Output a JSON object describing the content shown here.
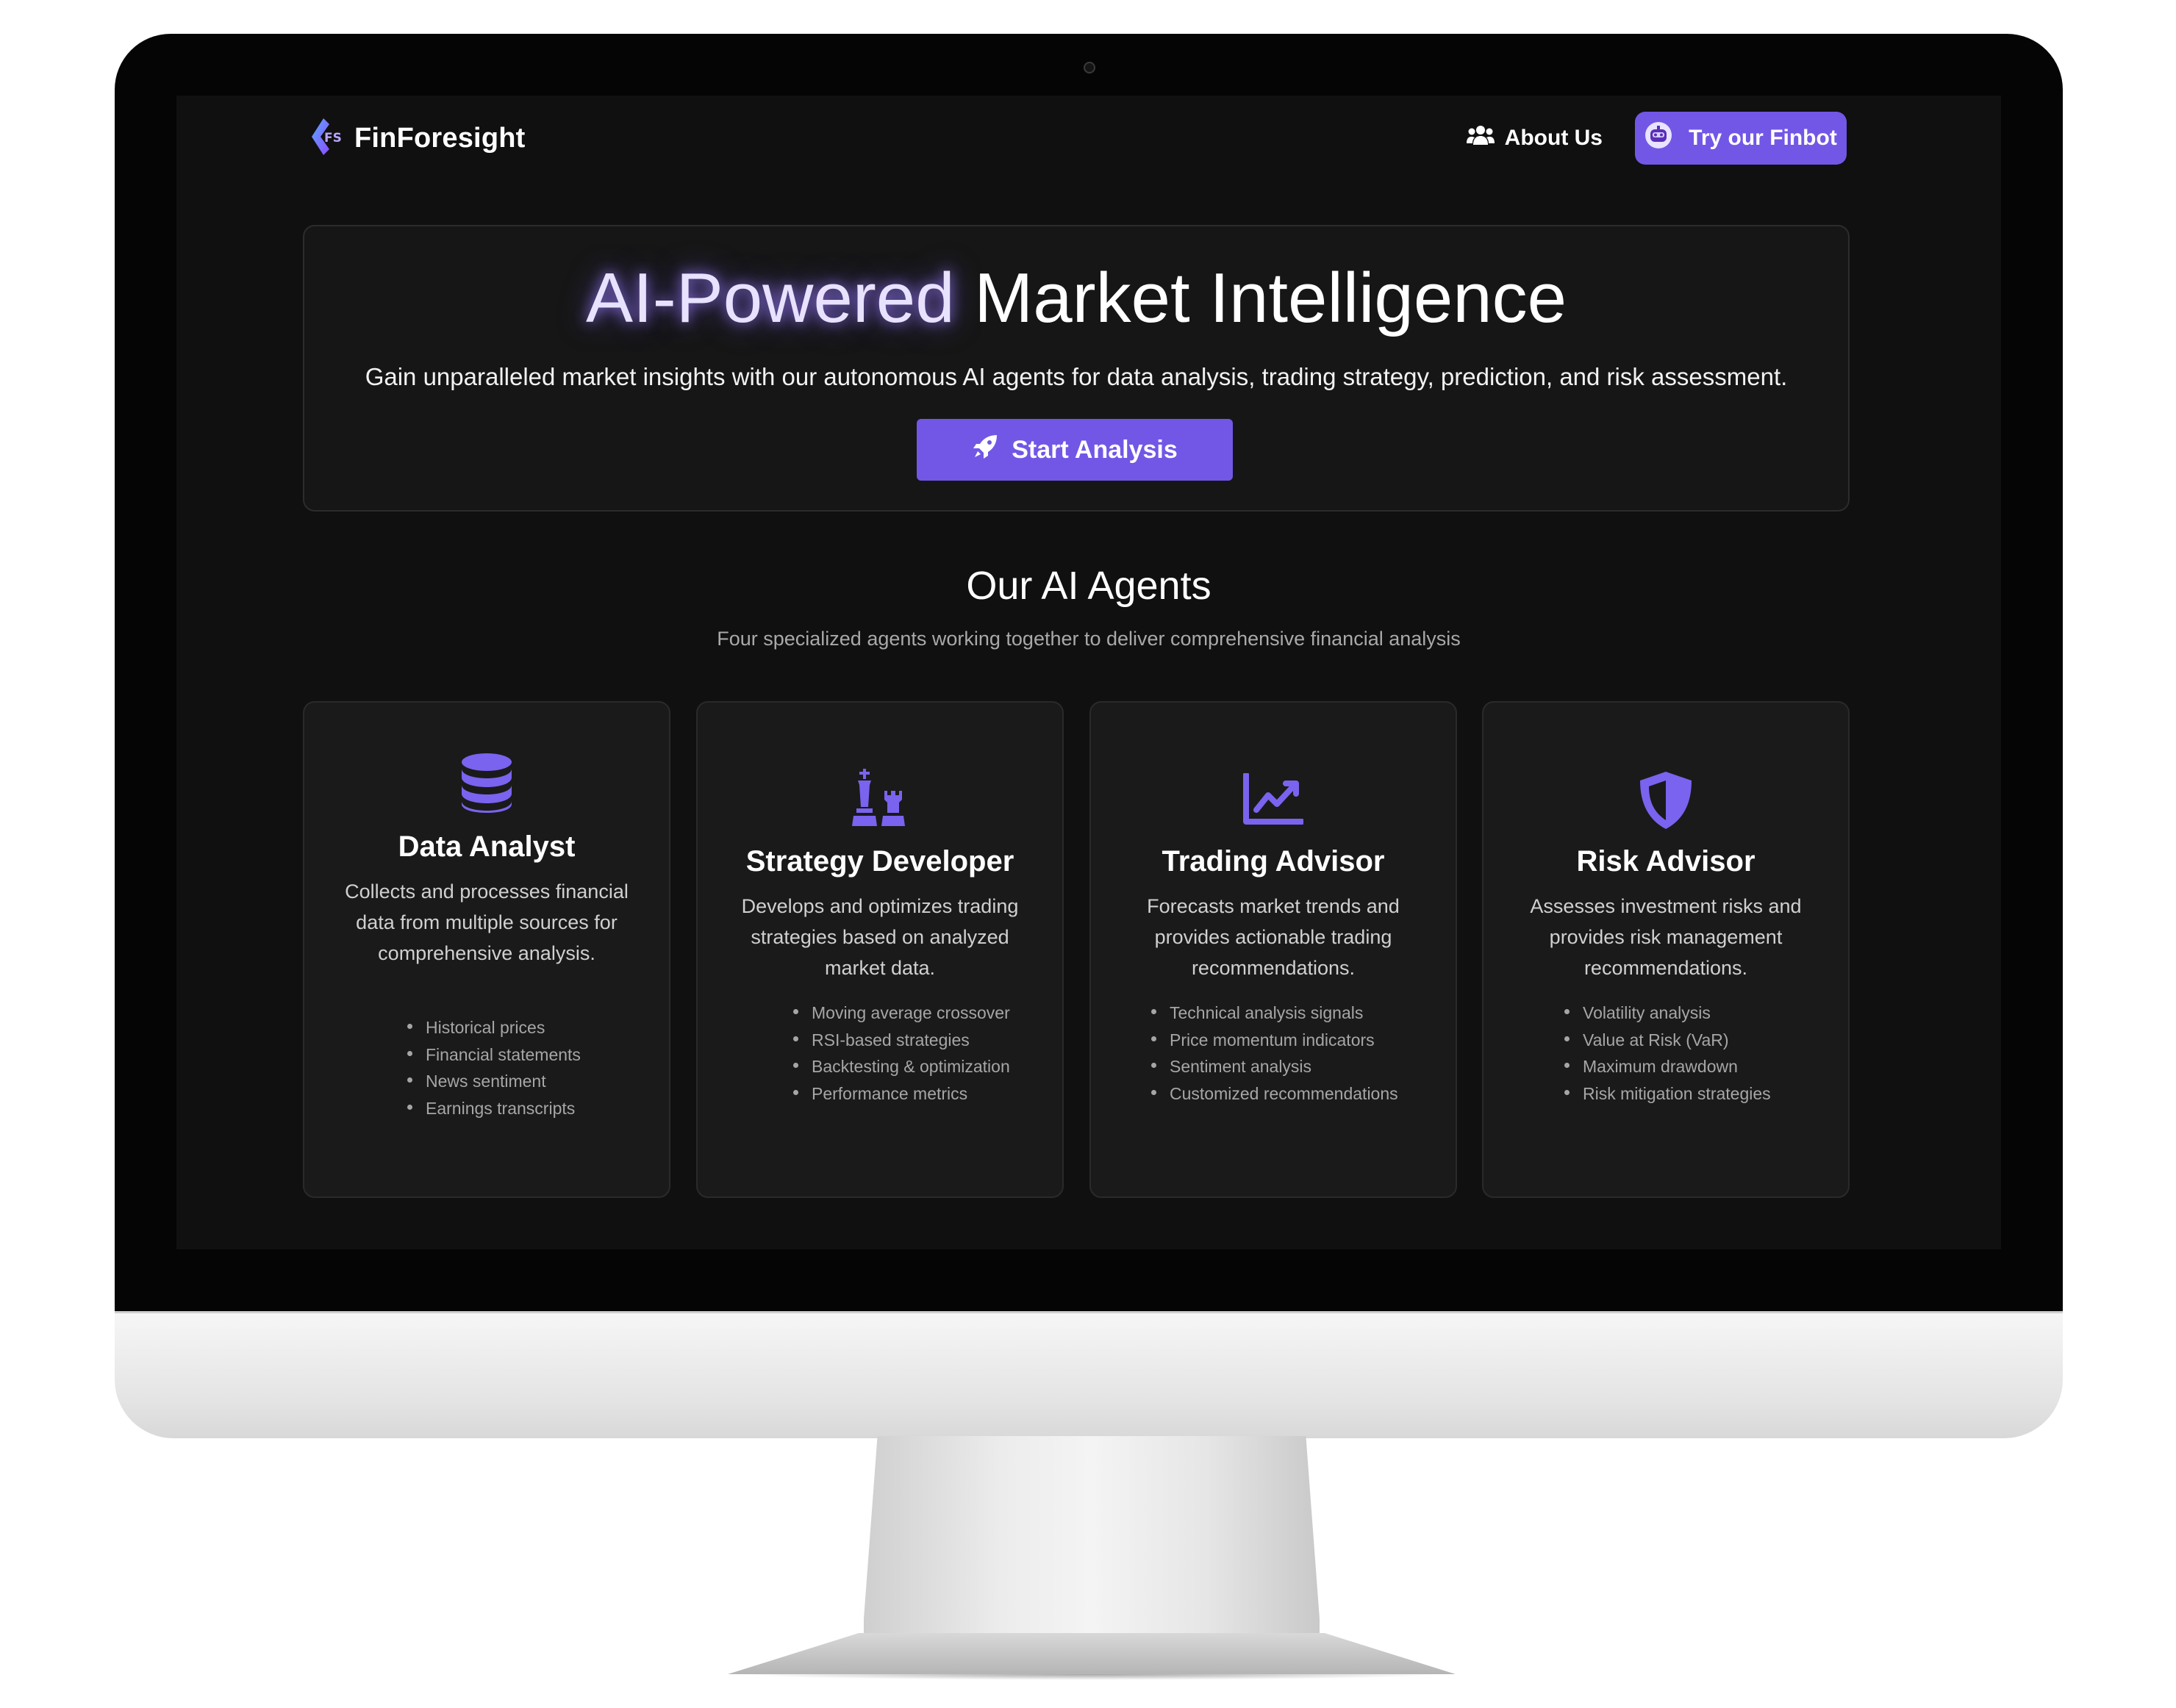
{
  "brand": {
    "name": "FinForesight",
    "logo_text": "FS"
  },
  "nav": {
    "about_label": "About Us",
    "finbot_label": "Try our Finbot"
  },
  "hero": {
    "title_glow": "AI-Powered",
    "title_rest": "Market Intelligence",
    "subtitle": "Gain unparalleled market insights with our autonomous AI agents for data analysis, trading strategy, prediction, and risk assessment.",
    "cta_label": "Start Analysis"
  },
  "agents_section": {
    "title": "Our AI Agents",
    "subtitle": "Four specialized agents working together to deliver comprehensive financial analysis"
  },
  "agents": [
    {
      "icon": "database-icon",
      "title": "Data Analyst",
      "description": "Collects and processes financial data from multiple sources for comprehensive analysis.",
      "features": [
        "Historical prices",
        "Financial statements",
        "News sentiment",
        "Earnings transcripts"
      ]
    },
    {
      "icon": "chess-icon",
      "title": "Strategy Developer",
      "description": "Develops and optimizes trading strategies based on analyzed market data.",
      "features": [
        "Moving average crossover",
        "RSI-based strategies",
        "Backtesting & optimization",
        "Performance metrics"
      ]
    },
    {
      "icon": "chart-line-icon",
      "title": "Trading Advisor",
      "description": "Forecasts market trends and provides actionable trading recommendations.",
      "features": [
        "Technical analysis signals",
        "Price momentum indicators",
        "Sentiment analysis",
        "Customized recommendations"
      ]
    },
    {
      "icon": "shield-icon",
      "title": "Risk Advisor",
      "description": "Assesses investment risks and provides risk management recommendations.",
      "features": [
        "Volatility analysis",
        "Value at Risk (VaR)",
        "Maximum drawdown",
        "Risk mitigation strategies"
      ]
    }
  ],
  "colors": {
    "accent": "#7257e6",
    "background": "#101010",
    "card": "#1a1a1a",
    "icon": "#7a63ee"
  }
}
